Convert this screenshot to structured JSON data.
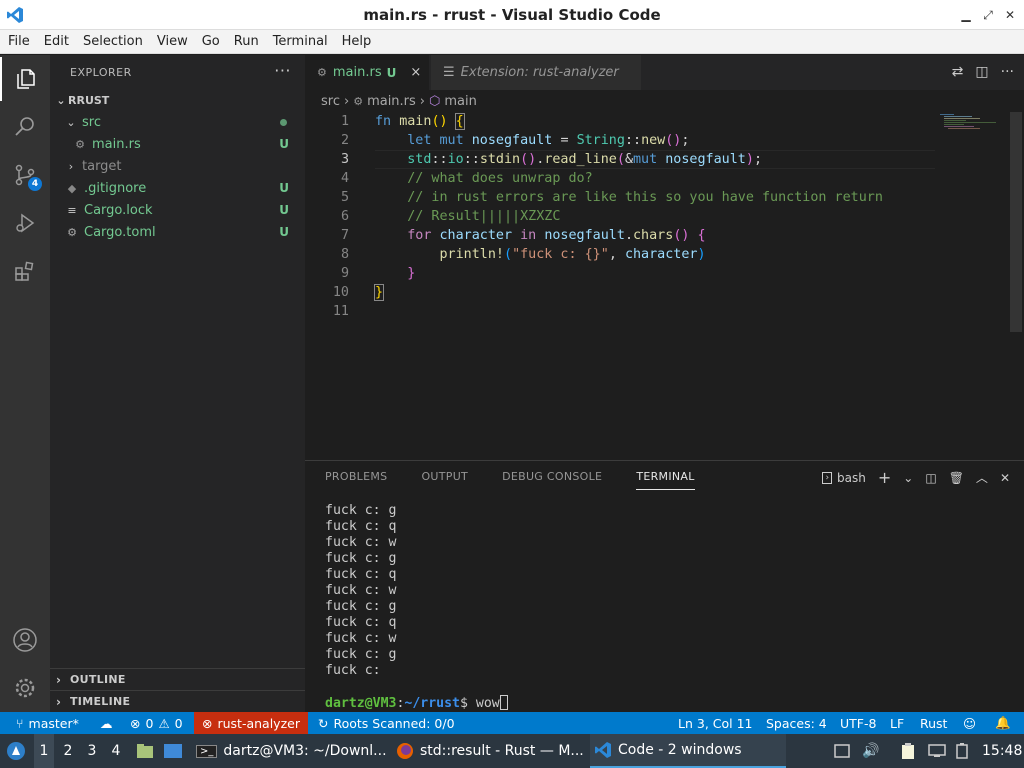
{
  "window": {
    "title": "main.rs - rrust - Visual Studio Code"
  },
  "menu": [
    "File",
    "Edit",
    "Selection",
    "View",
    "Go",
    "Run",
    "Terminal",
    "Help"
  ],
  "activity": {
    "scm_badge": "4"
  },
  "sidebar": {
    "header": "EXPLORER",
    "more": "···",
    "root": "RRUST",
    "items": [
      {
        "label": "src",
        "status": ""
      },
      {
        "label": "main.rs",
        "status": "U"
      },
      {
        "label": "target",
        "status": ""
      },
      {
        "label": ".gitignore",
        "status": "U"
      },
      {
        "label": "Cargo.lock",
        "status": "U"
      },
      {
        "label": "Cargo.toml",
        "status": "U"
      }
    ],
    "outline": "OUTLINE",
    "timeline": "TIMELINE"
  },
  "tabs": [
    {
      "label": "main.rs",
      "status": "U",
      "close": "×"
    },
    {
      "label": "Extension: rust-analyzer"
    }
  ],
  "breadcrumb": {
    "folder": "src",
    "file": "main.rs",
    "symbol": "main"
  },
  "code": {
    "line_numbers": [
      "1",
      "2",
      "3",
      "4",
      "5",
      "6",
      "7",
      "8",
      "9",
      "10",
      "11"
    ],
    "current_line": "3"
  },
  "panel": {
    "tabs": [
      "PROBLEMS",
      "OUTPUT",
      "DEBUG CONSOLE",
      "TERMINAL"
    ],
    "shell": "bash",
    "terminal_lines": [
      "fuck c: g",
      "fuck c: q",
      "fuck c: w",
      "fuck c: g",
      "fuck c: q",
      "fuck c: w",
      "fuck c: g",
      "fuck c: q",
      "fuck c: w",
      "fuck c: g",
      "fuck c:"
    ],
    "prompt_user": "dartz@VM3",
    "prompt_sep": ":",
    "prompt_path": "~/rrust",
    "prompt_symbol": "$",
    "command": "wow"
  },
  "statusbar": {
    "branch": "master*",
    "errors": "0",
    "warnings": "0",
    "analyzer": "rust-analyzer",
    "roots": "Roots Scanned: 0/0",
    "position": "Ln 3, Col 11",
    "spaces": "Spaces: 4",
    "encoding": "UTF-8",
    "eol": "LF",
    "language": "Rust"
  },
  "taskbar": {
    "workspaces": [
      "1",
      "2",
      "3",
      "4"
    ],
    "windows": [
      {
        "label": "dartz@VM3: ~/Downl..."
      },
      {
        "label": "std::result - Rust — M..."
      },
      {
        "label": "Code - 2 windows"
      }
    ],
    "clock": "15:48"
  }
}
